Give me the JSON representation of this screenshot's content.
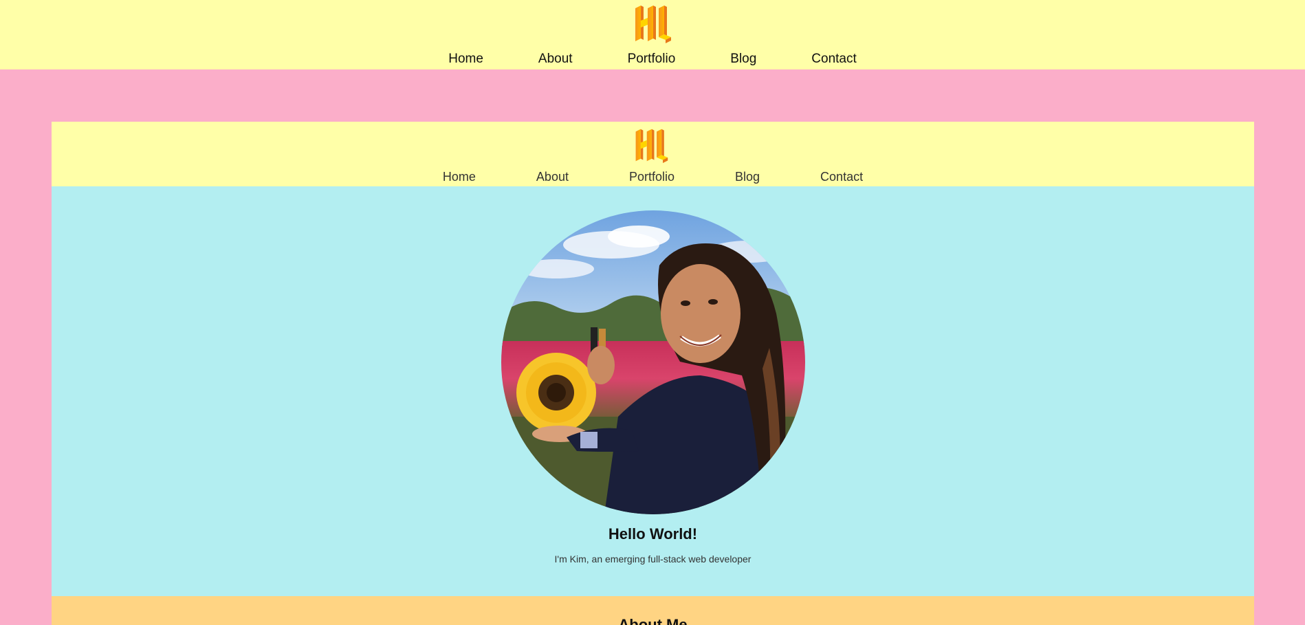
{
  "site_header": {
    "nav": [
      "Home",
      "About",
      "Portfolio",
      "Blog",
      "Contact"
    ]
  },
  "preview": {
    "nav": [
      "Home",
      "About",
      "Portfolio",
      "Blog",
      "Contact"
    ],
    "hero": {
      "title": "Hello World!",
      "subtitle": "I'm Kim, an emerging full-stack web developer"
    },
    "about": {
      "title": "About Me"
    }
  },
  "colors": {
    "page_bg": "#fbaec9",
    "header_bg": "#ffffa8",
    "hero_bg": "#b3eef1",
    "about_bg": "#ffd483",
    "logo_orange": "#f7941d",
    "logo_yellow": "#ffd400"
  },
  "icons": {
    "logo": "hl-monogram-logo",
    "avatar": "profile-photo"
  }
}
